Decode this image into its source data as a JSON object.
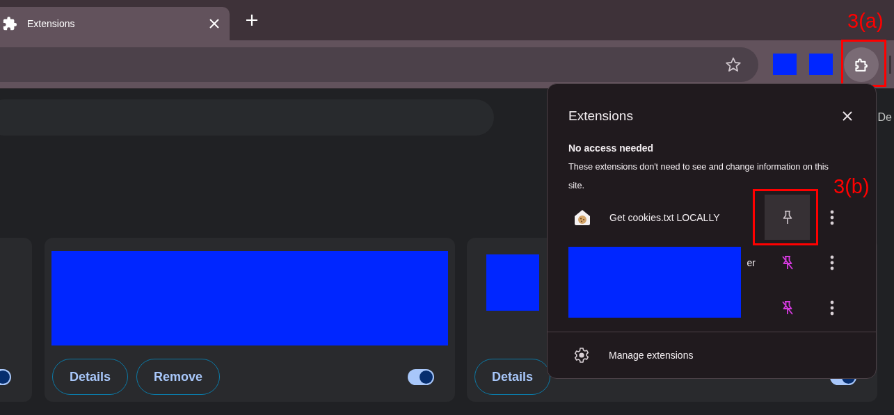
{
  "tabs": [
    {
      "label": "Extensions",
      "selected": true
    }
  ],
  "toolbar": {
    "extensions_button": {
      "annotation": "3(a)"
    }
  },
  "page": {
    "side_link": "De",
    "cards": [
      {
        "enabled": true
      },
      {
        "kind": "wide",
        "enabled": true,
        "buttons": [
          "Details",
          "Remove"
        ]
      },
      {
        "kind": "square",
        "enabled": true,
        "buttons": [
          "Details"
        ]
      }
    ]
  },
  "popup": {
    "title": "Extensions",
    "section_title": "No access needed",
    "section_text": "These extensions don't need to see and change information on this site.",
    "extensions": [
      {
        "name": "Get cookies.txt LOCALLY",
        "pinned": false,
        "highlighted": true,
        "obscured": false,
        "annotation": "3(b)"
      },
      {
        "name": "er",
        "pinned": true,
        "highlighted": false,
        "obscured": true
      },
      {
        "pinned": true,
        "highlighted": false,
        "obscured": true
      }
    ],
    "footer": "Manage extensions"
  }
}
